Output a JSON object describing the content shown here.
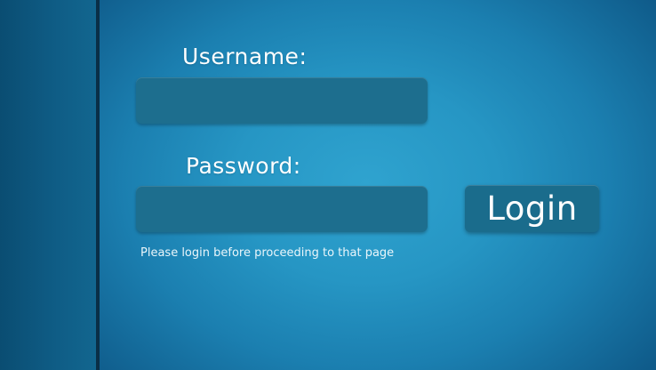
{
  "login_form": {
    "username_label": "Username:",
    "username_value": "",
    "password_label": "Password:",
    "password_value": "",
    "login_button_label": "Login",
    "message": "Please login before proceeding to that page"
  },
  "colors": {
    "background": "#2696c4",
    "sidebar": "#0f5d86",
    "field": "#1d6e8e",
    "button": "#1a6c8c",
    "text": "#ffffff"
  }
}
